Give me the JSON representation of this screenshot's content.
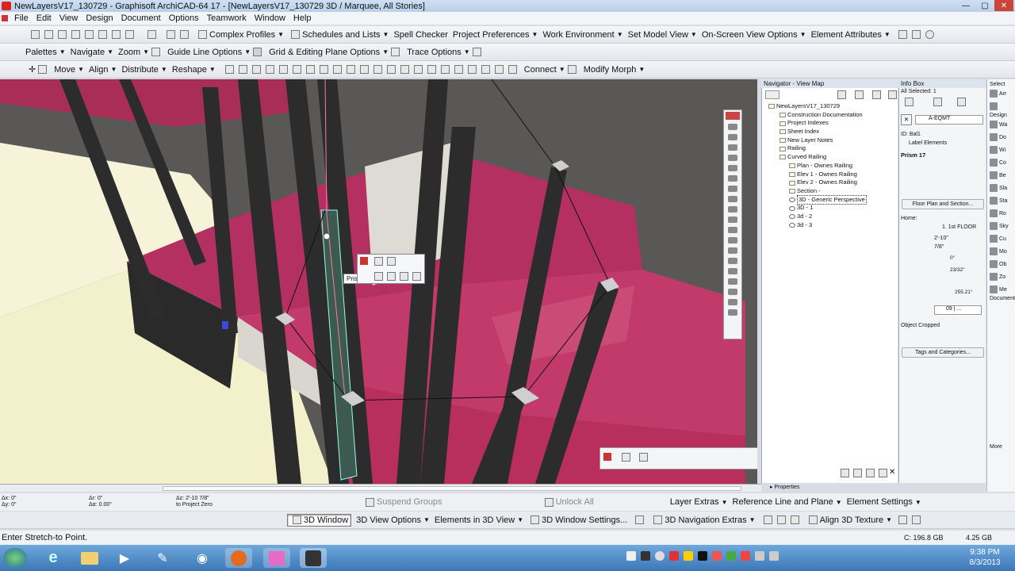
{
  "window": {
    "title": "NewLayersV17_130729 - Graphisoft ArchiCAD-64 17 - [NewLayersV17_130729 3D / Marquee, All Stories]"
  },
  "menu": [
    "File",
    "Edit",
    "View",
    "Design",
    "Document",
    "Options",
    "Teamwork",
    "Window",
    "Help"
  ],
  "toolbar1": {
    "complex_profiles": "Complex Profiles",
    "schedules_lists": "Schedules and Lists",
    "spell_checker": "Spell Checker",
    "project_preferences": "Project Preferences",
    "work_environment": "Work Environment",
    "set_model_view": "Set Model View",
    "onscreen_view_options": "On-Screen View Options",
    "element_attributes": "Element Attributes"
  },
  "toolbar2": {
    "palettes": "Palettes",
    "navigate": "Navigate",
    "zoom": "Zoom",
    "guide_line_options": "Guide Line Options",
    "grid_editing": "Grid & Editing Plane Options",
    "trace_options": "Trace Options"
  },
  "toolbar3": {
    "move": "Move",
    "align": "Align",
    "distribute": "Distribute",
    "reshape": "Reshape",
    "connect": "Connect",
    "modify_morph": "Modify Morph"
  },
  "viewport": {
    "popup_label": "Pris"
  },
  "navigator": {
    "title": "Navigator - View Map",
    "root": "NewLayersV17_130729",
    "items": [
      "Construction Documentation",
      "Project Indexes",
      "Sheet Index",
      "New Layer Notes",
      "Railing",
      "Curved Railing"
    ],
    "views": [
      "Plan - Ownes Railing",
      "Elev 1 - Ownes Railing",
      "Elev 2 - Ownes Railing",
      "Section -",
      "3D - Generic Perspective",
      "3D - 1",
      "3d - 2",
      "3d - 3"
    ],
    "properties": "Properties"
  },
  "infobox": {
    "title": "Info Box",
    "selected": "All Selected: 1",
    "layer": "A-EQMT",
    "id_label": "ID:",
    "id_value": "Bal1",
    "label_elements": "Label Elements",
    "prism": "Prism 17",
    "floor_plan_section": "Floor Plan and Section...",
    "home_label": "Home:",
    "home_value": "1. 1st FLOOR",
    "h_value": "2'-10\"",
    "b_value": "7/8\"",
    "angle_value": "0\"",
    "slope_value": "23/32\"",
    "area_value": "255.21°",
    "pen_value": "09 | ...",
    "object_cropped": "Object Cropped",
    "tags_categories": "Tags and Categories..."
  },
  "toolbox": {
    "select": "Select",
    "design": "Design",
    "document": "Document",
    "more": "More",
    "items": [
      "Arr",
      "Wa",
      "Do",
      "Wi",
      "Co",
      "Be",
      "Sla",
      "Sta",
      "Ro",
      "Sky",
      "Cu",
      "Mo",
      "Ob",
      "Zo",
      "Me"
    ]
  },
  "coords": {
    "dx": "Δx: 0\"",
    "dy": "Δy: 0\"",
    "dr": "Δr: 0\"",
    "da": "Δα: 0.00°",
    "dz": "Δz: 2'-10 7/8\"",
    "to_project_zero": "to Project Zero"
  },
  "bottom_toolbar1": {
    "suspend_groups": "Suspend Groups",
    "unlock_all": "Unlock All",
    "layer_extras": "Layer Extras",
    "reference_line": "Reference Line and Plane",
    "element_settings": "Element Settings"
  },
  "bottom_toolbar2": {
    "window_3d": "3D Window",
    "view_options_3d": "3D View Options",
    "elements_3d": "Elements in 3D View",
    "window_settings_3d": "3D Window Settings...",
    "navigation_extras_3d": "3D Navigation Extras",
    "align_3d_texture": "Align 3D Texture"
  },
  "status": {
    "message": "Enter Stretch-to Point.",
    "disk": "C: 196.8 GB",
    "ram": "4.25 GB"
  },
  "taskbar": {
    "time": "9:38 PM",
    "date": "8/3/2013"
  },
  "colors": {
    "railing": "#b0305e",
    "post": "#2e2e2e",
    "titlebar": "#b9cfe8",
    "taskbar": "#3c77b8"
  }
}
